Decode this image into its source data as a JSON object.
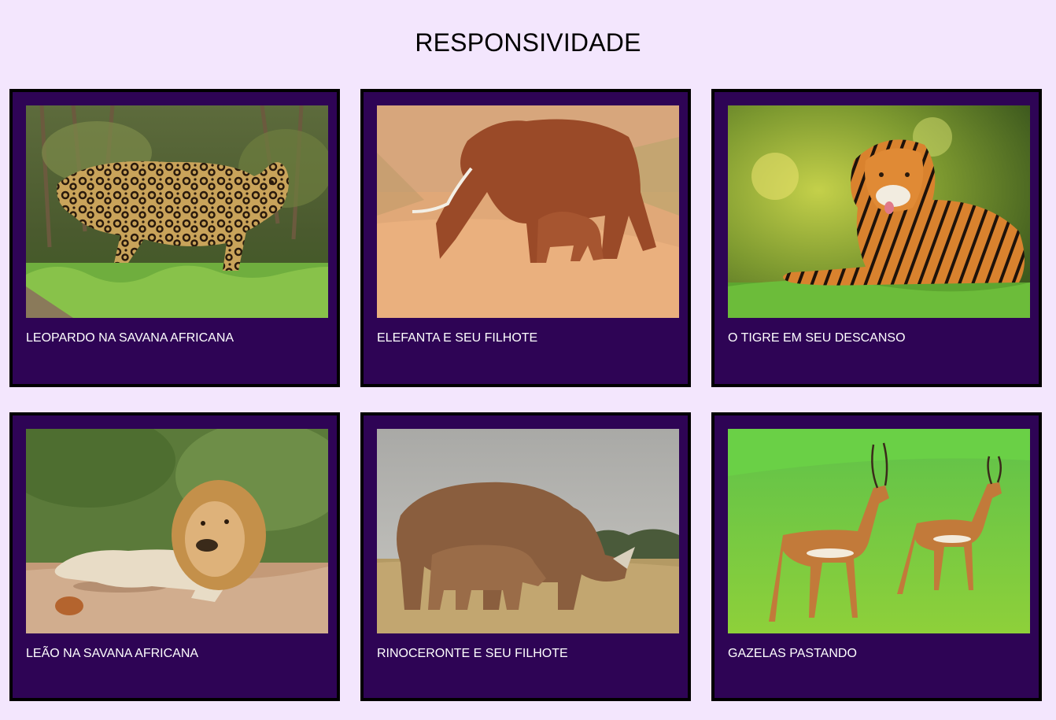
{
  "header": {
    "title": "RESPONSIVIDADE"
  },
  "colors": {
    "background": "#f3e6fd",
    "card": "#2e0455",
    "card_border": "#000000",
    "caption_text": "#ffffff"
  },
  "cards": [
    {
      "caption": "LEOPARDO NA SAVANA AFRICANA",
      "image": "leopard-photo"
    },
    {
      "caption": "ELEFANTA E SEU FILHOTE",
      "image": "elephant-photo"
    },
    {
      "caption": "O TIGRE EM SEU DESCANSO",
      "image": "tiger-photo"
    },
    {
      "caption": "LEÃO NA SAVANA AFRICANA",
      "image": "lion-photo"
    },
    {
      "caption": "RINOCERONTE E SEU FILHOTE",
      "image": "rhino-photo"
    },
    {
      "caption": "GAZELAS PASTANDO",
      "image": "gazelle-photo"
    }
  ]
}
